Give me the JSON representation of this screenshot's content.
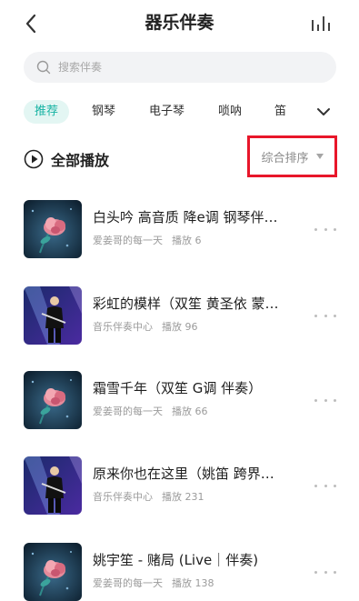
{
  "header": {
    "title": "器乐伴奏"
  },
  "search": {
    "placeholder": "搜索伴奏"
  },
  "tabs": [
    {
      "label": "推荐",
      "active": true
    },
    {
      "label": "钢琴",
      "active": false
    },
    {
      "label": "电子琴",
      "active": false
    },
    {
      "label": "唢呐",
      "active": false
    },
    {
      "label": "笛",
      "active": false
    }
  ],
  "play_all": {
    "label": "全部播放"
  },
  "sort": {
    "label": "综合排序"
  },
  "songs": [
    {
      "title": "白头吟 高音质 降e调 钢琴伴…",
      "uploader": "爱姜哥的每一天",
      "plays": "播放 6",
      "thumb": "flower"
    },
    {
      "title": "彩虹的模样（双笙 黄圣依 蒙…",
      "uploader": "音乐伴奏中心",
      "plays": "播放 96",
      "thumb": "performer"
    },
    {
      "title": "霜雪千年（双笙 G调 伴奏）",
      "uploader": "爱姜哥的每一天",
      "plays": "播放 66",
      "thumb": "flower"
    },
    {
      "title": "原来你也在这里（姚笛 跨界…",
      "uploader": "音乐伴奏中心",
      "plays": "播放 231",
      "thumb": "performer"
    },
    {
      "title": "姚宇笙 - 赌局 (Live｜伴奏)",
      "uploader": "爱姜哥的每一天",
      "plays": "播放 138",
      "thumb": "flower"
    }
  ],
  "colors": {
    "accent": "#17b3a3",
    "highlight_box": "#e8162a"
  }
}
